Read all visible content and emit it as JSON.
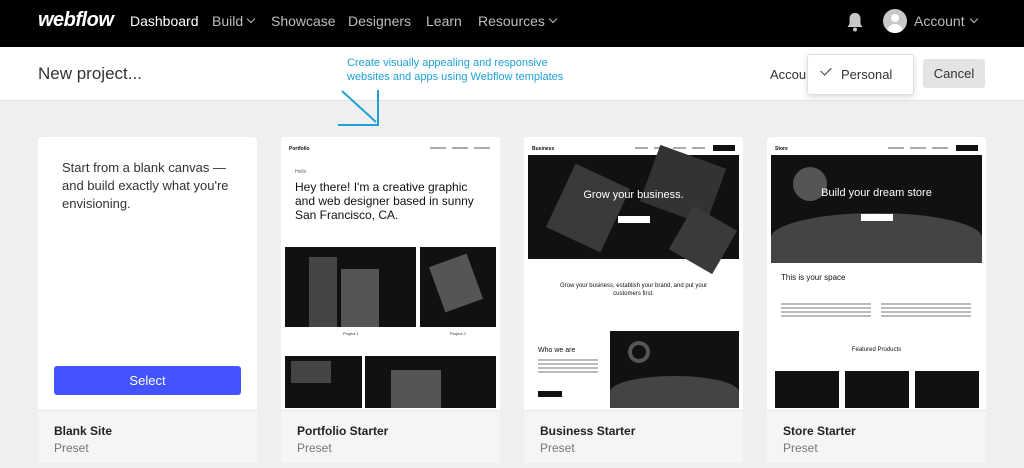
{
  "nav": {
    "logo": "webflow",
    "items": [
      {
        "label": "Dashboard",
        "active": true,
        "dropdown": false
      },
      {
        "label": "Build",
        "active": false,
        "dropdown": true
      },
      {
        "label": "Showcase",
        "active": false,
        "dropdown": false
      },
      {
        "label": "Designers",
        "active": false,
        "dropdown": false
      },
      {
        "label": "Learn",
        "active": false,
        "dropdown": false
      },
      {
        "label": "Resources",
        "active": false,
        "dropdown": true
      }
    ],
    "account_label": "Account",
    "icons": {
      "notifications": "bell-icon",
      "avatar": "user-avatar-icon"
    }
  },
  "header": {
    "title": "New project...",
    "annotation": "Create visually appealing and responsive websites and apps using Webflow templates",
    "account_label": "Account",
    "workspace_dropdown": {
      "selected": "Personal"
    },
    "cancel_label": "Cancel"
  },
  "colors": {
    "accent": "#4353ff",
    "annotation": "#1ea1d6",
    "nav_bg": "#000000"
  },
  "cards": [
    {
      "title": "Blank Site",
      "subtitle": "Preset",
      "description": "Start from a blank canvas — and build exactly what you're envisioning.",
      "button": "Select"
    },
    {
      "title": "Portfolio Starter",
      "subtitle": "Preset",
      "preview": {
        "brand": "Portfolio",
        "eyebrow": "Hello",
        "headline": "Hey there! I'm a creative graphic and web designer based in sunny San Francisco, CA.",
        "project1": "Project 1",
        "project2": "Project 2"
      }
    },
    {
      "title": "Business Starter",
      "subtitle": "Preset",
      "preview": {
        "brand": "Business",
        "hero": "Grow your business.",
        "tagline": "Grow your business, establish your brand, and put your customers first.",
        "section": "Who we are"
      }
    },
    {
      "title": "Store Starter",
      "subtitle": "Preset",
      "preview": {
        "brand": "Store",
        "hero": "Build your dream store",
        "section": "This is your space",
        "featured": "Featured Products"
      }
    }
  ]
}
